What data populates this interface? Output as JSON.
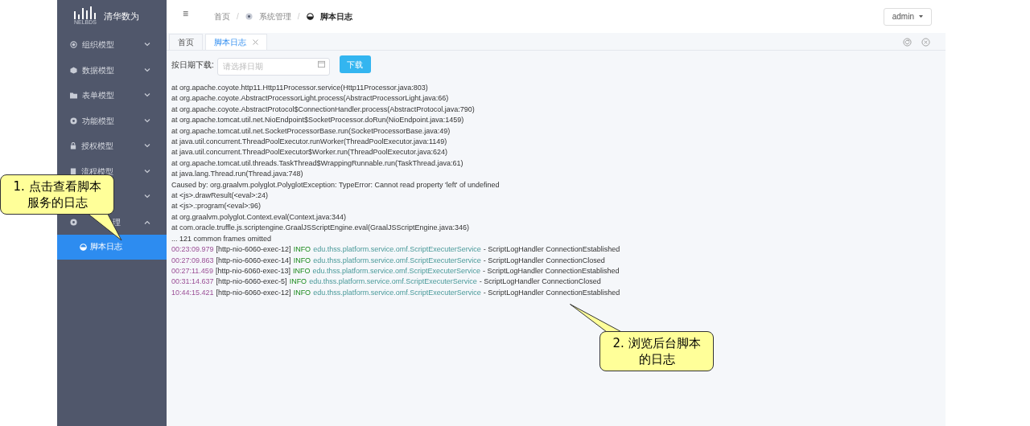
{
  "logo": {
    "mark": "NELBDS",
    "name": "清华数为"
  },
  "sidebar": {
    "items": [
      {
        "label": "组织模型",
        "expanded": false
      },
      {
        "label": "数据模型",
        "expanded": false
      },
      {
        "label": "表单模型",
        "expanded": false
      },
      {
        "label": "功能模型",
        "expanded": false
      },
      {
        "label": "授权模型",
        "expanded": false
      },
      {
        "label": "流程模型",
        "expanded": false
      },
      {
        "expanded": false
      },
      {
        "label": "理",
        "expanded": true,
        "children": [
          {
            "label": "脚本日志",
            "selected": true
          }
        ]
      }
    ]
  },
  "header": {
    "menu_glyph": "≡",
    "separator": "/",
    "breadcrumb": [
      {
        "label": "首页"
      },
      {
        "label": "系统管理"
      },
      {
        "label": "脚本日志"
      }
    ],
    "user": "admin"
  },
  "tabs": [
    {
      "label": "首页",
      "selected": false,
      "closable": false
    },
    {
      "label": "脚本日志",
      "selected": true,
      "closable": true
    }
  ],
  "toolbar": {
    "label": "按日期下载:",
    "date_placeholder": "请选择日期",
    "button": "下载"
  },
  "log": [
    {
      "kind": "plain",
      "text": "at org.apache.coyote.http11.Http11Processor.service(Http11Processor.java:803)"
    },
    {
      "kind": "plain",
      "text": "at org.apache.coyote.AbstractProcessorLight.process(AbstractProcessorLight.java:66)"
    },
    {
      "kind": "plain",
      "text": "at org.apache.coyote.AbstractProtocol$ConnectionHandler.process(AbstractProtocol.java:790)"
    },
    {
      "kind": "plain",
      "text": "at org.apache.tomcat.util.net.NioEndpoint$SocketProcessor.doRun(NioEndpoint.java:1459)"
    },
    {
      "kind": "plain",
      "text": "at org.apache.tomcat.util.net.SocketProcessorBase.run(SocketProcessorBase.java:49)"
    },
    {
      "kind": "plain",
      "text": "at java.util.concurrent.ThreadPoolExecutor.runWorker(ThreadPoolExecutor.java:1149)"
    },
    {
      "kind": "plain",
      "text": "at java.util.concurrent.ThreadPoolExecutor$Worker.run(ThreadPoolExecutor.java:624)"
    },
    {
      "kind": "plain",
      "text": "at org.apache.tomcat.util.threads.TaskThread$WrappingRunnable.run(TaskThread.java:61)"
    },
    {
      "kind": "plain",
      "text": "at java.lang.Thread.run(Thread.java:748)"
    },
    {
      "kind": "plain",
      "text": "Caused by: org.graalvm.polyglot.PolyglotException: TypeError: Cannot read property 'left' of undefined"
    },
    {
      "kind": "plain",
      "text": "at <js>.drawResult(<eval>:24)"
    },
    {
      "kind": "plain",
      "text": "at <js>.:program(<eval>:96)"
    },
    {
      "kind": "plain",
      "text": "at org.graalvm.polyglot.Context.eval(Context.java:344)"
    },
    {
      "kind": "plain",
      "text": "at com.oracle.truffle.js.scriptengine.GraalJSScriptEngine.eval(GraalJSScriptEngine.java:346)"
    },
    {
      "kind": "plain",
      "text": "... 121 common frames omitted"
    },
    {
      "kind": "entry",
      "time": "00:23:09.979",
      "thread": "[http-nio-6060-exec-12]",
      "level": "INFO",
      "logger": "edu.thss.platform.service.omf.ScriptExecuterService",
      "message": "- ScriptLogHandler ConnectionEstablished"
    },
    {
      "kind": "entry",
      "time": "00:27:09.863",
      "thread": "[http-nio-6060-exec-14]",
      "level": "INFO",
      "logger": "edu.thss.platform.service.omf.ScriptExecuterService",
      "message": "- ScriptLogHandler ConnectionClosed"
    },
    {
      "kind": "entry",
      "time": "00:27:11.459",
      "thread": "[http-nio-6060-exec-13]",
      "level": "INFO",
      "logger": "edu.thss.platform.service.omf.ScriptExecuterService",
      "message": "- ScriptLogHandler ConnectionEstablished"
    },
    {
      "kind": "entry",
      "time": "00:31:14.637",
      "thread": "[http-nio-6060-exec-5]",
      "level": "INFO",
      "logger": "edu.thss.platform.service.omf.ScriptExecuterService",
      "message": "- ScriptLogHandler ConnectionClosed"
    },
    {
      "kind": "entry",
      "time": "10:44:15.421",
      "thread": "[http-nio-6060-exec-12]",
      "level": "INFO",
      "logger": "edu.thss.platform.service.omf.ScriptExecuterService",
      "message": "- ScriptLogHandler ConnectionEstablished"
    }
  ],
  "callouts": [
    {
      "text": "1. 点击查看脚本服务的日志"
    },
    {
      "text": "2. 浏览后台脚本的日志"
    }
  ]
}
